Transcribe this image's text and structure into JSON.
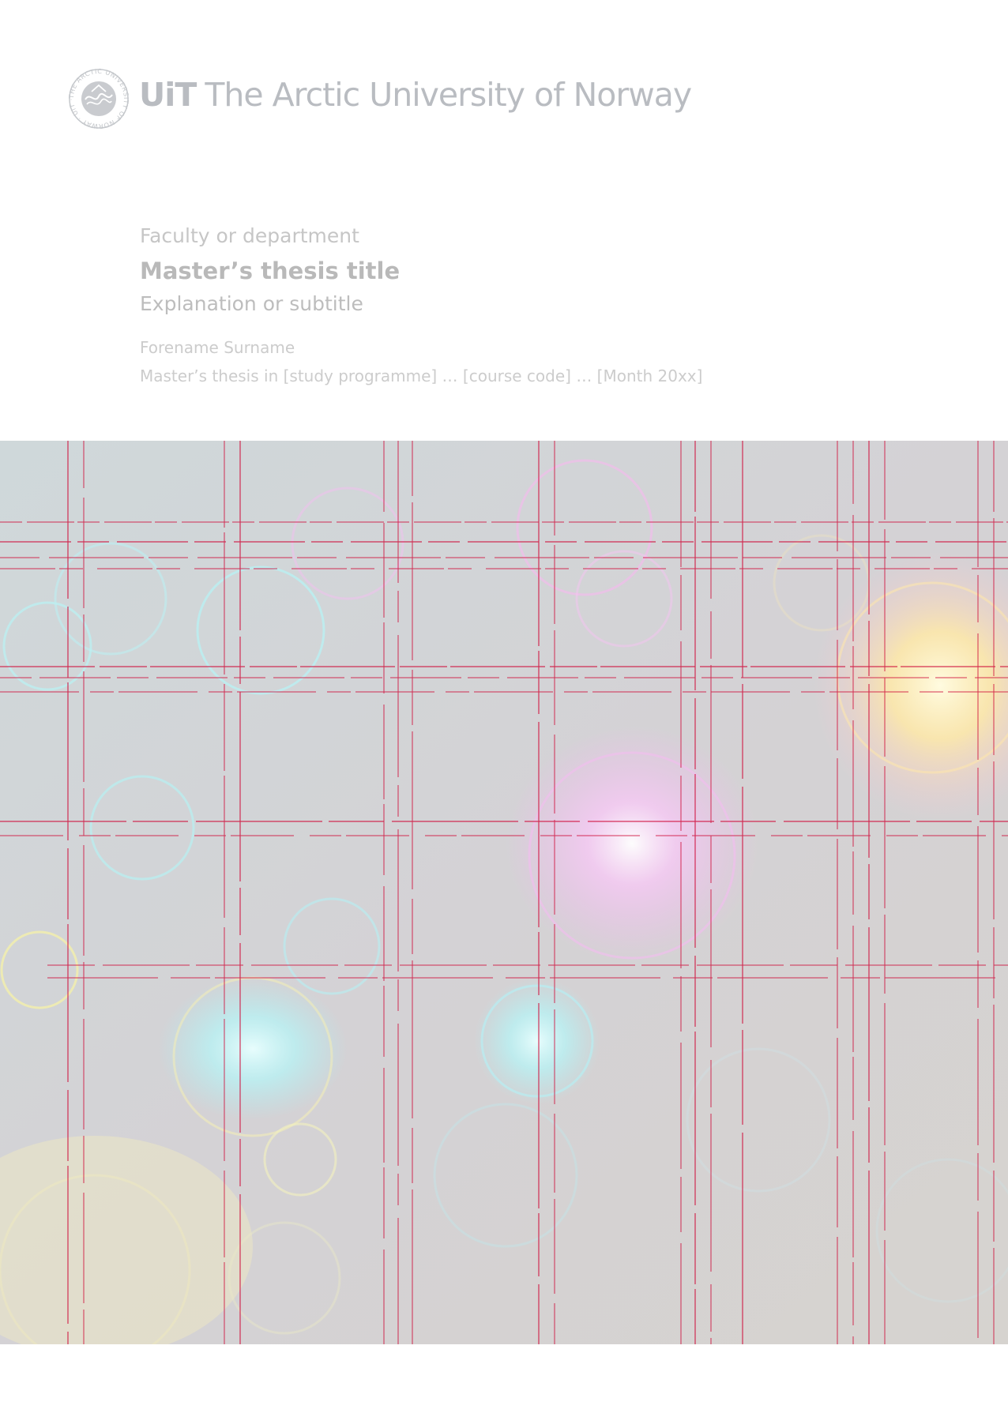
{
  "header": {
    "logo_seal_text": "THE ARCTIC UNIVERSITY OF NORWAY · UiT ·",
    "wordmark_uit": "UiT",
    "wordmark_rest": "The Arctic University of Norway"
  },
  "title_block": {
    "faculty": "Faculty or department",
    "thesis_title": "Master’s thesis title",
    "subtitle": "Explanation or subtitle",
    "author": "Forename Surname",
    "programme_line": "Master’s thesis in [study programme] … [course code] … [Month 20xx]"
  },
  "cover_image": {
    "description_colors": {
      "base": "#d3d3d5",
      "cyan": "#a9f3f6",
      "magenta": "#f6b6f3",
      "yellow": "#fff0a6",
      "grid_line": "#d0103c"
    }
  }
}
